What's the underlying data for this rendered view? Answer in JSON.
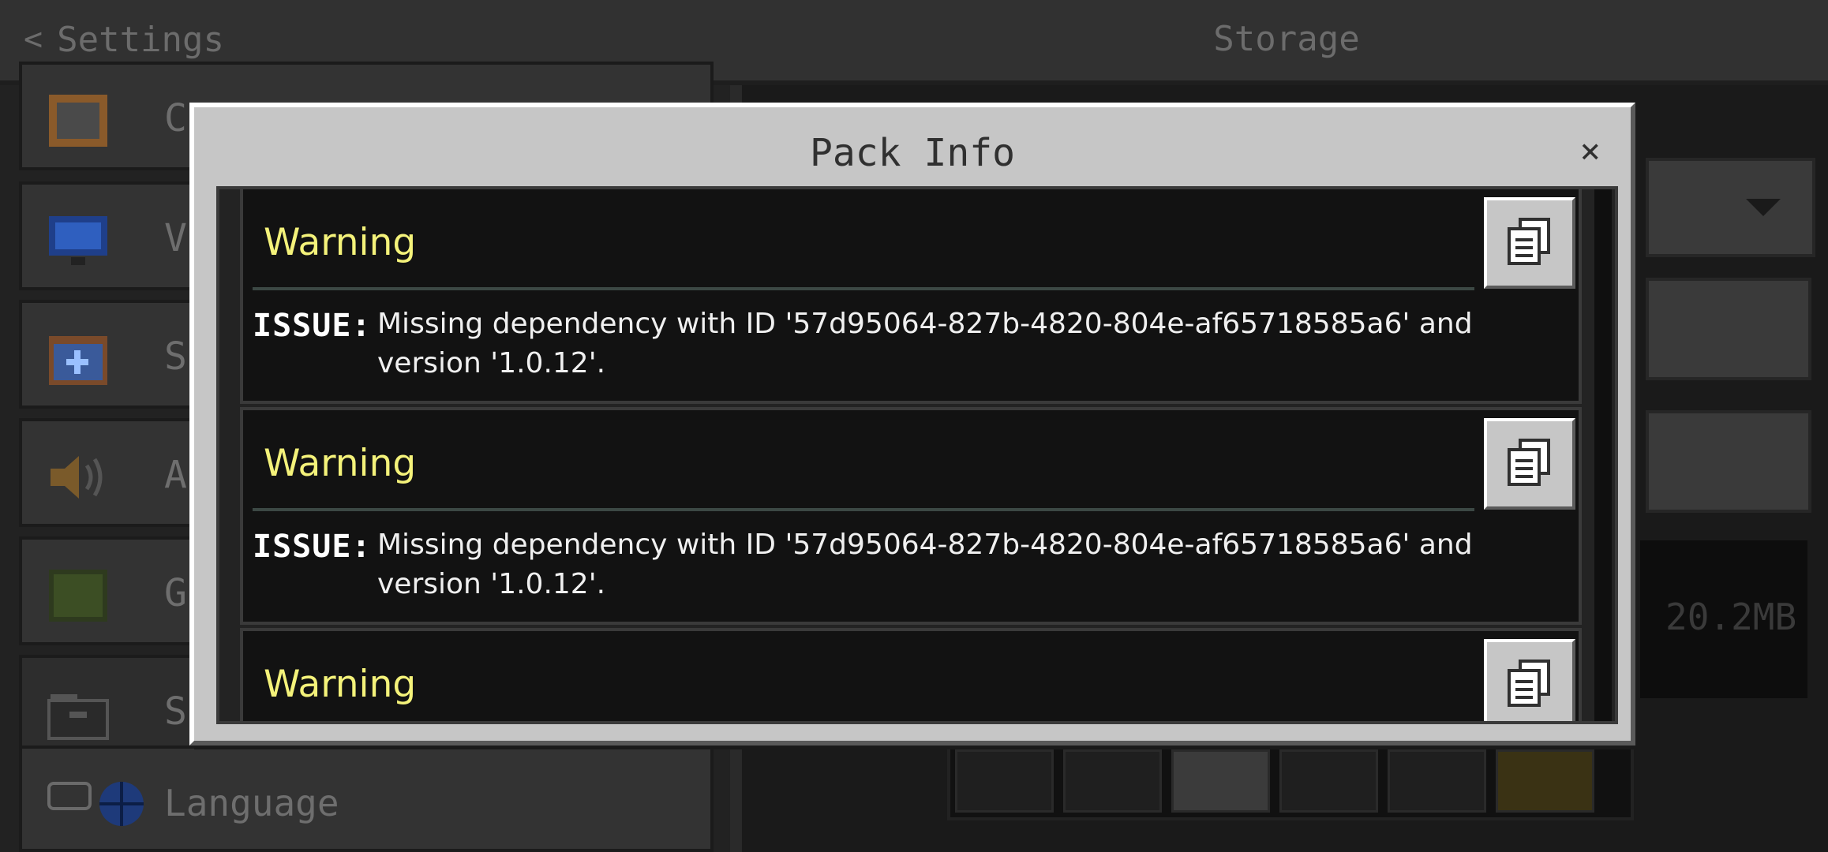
{
  "header": {
    "back_label": "Settings",
    "title": "Storage"
  },
  "sidebar": {
    "items": [
      {
        "label": "Creator",
        "icon": "creator-icon"
      },
      {
        "label": "V",
        "icon": "video-monitor-icon"
      },
      {
        "label": "S",
        "icon": "calendar-plus-icon"
      },
      {
        "label": "A",
        "icon": "speaker-icon"
      },
      {
        "label": "G",
        "icon": "grass-block-icon"
      },
      {
        "label": "S",
        "icon": "folder-icon"
      }
    ],
    "language_label": "Language"
  },
  "storage": {
    "size_label": "20.2MB"
  },
  "modal": {
    "title": "Pack Info",
    "close_label": "×",
    "entries": [
      {
        "heading": "Warning",
        "issue_label": "ISSUE:",
        "message": "Missing dependency with ID '57d95064-827b-4820-804e-af65718585a6' and version '1.0.12'."
      },
      {
        "heading": "Warning",
        "issue_label": "ISSUE:",
        "message": "Missing dependency with ID '57d95064-827b-4820-804e-af65718585a6' and version '1.0.12'."
      },
      {
        "heading": "Warning"
      }
    ]
  },
  "colors": {
    "warning": "#f4f27a",
    "modal_bg": "#c6c6c6",
    "card_bg": "#121212"
  }
}
